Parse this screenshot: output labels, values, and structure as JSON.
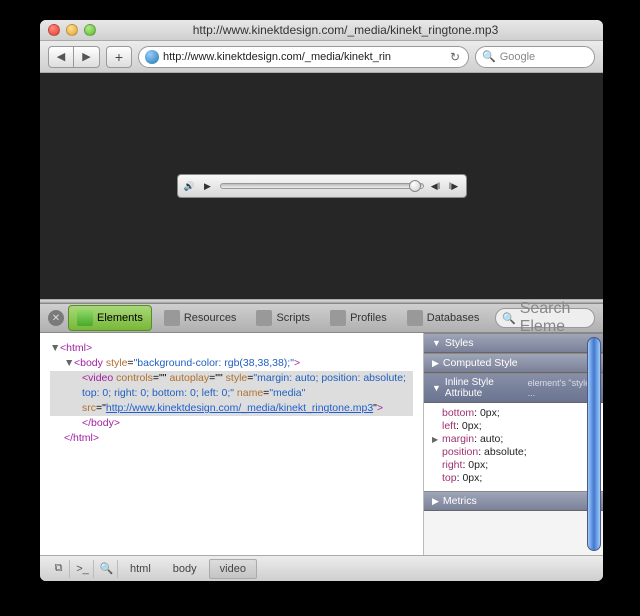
{
  "window": {
    "title": "http://www.kinektdesign.com/_media/kinekt_ringtone.mp3"
  },
  "toolbar": {
    "url": "http://www.kinektdesign.com/_media/kinekt_rin",
    "search_placeholder": "Google"
  },
  "devtools": {
    "tabs": [
      "Elements",
      "Resources",
      "Scripts",
      "Profiles",
      "Databases"
    ],
    "search_placeholder": "Search Eleme",
    "styles": {
      "header": "Styles",
      "computed": "Computed Style",
      "inline_header": "Inline Style Attribute",
      "inline_note": "element's \"style\" ...",
      "metrics": "Metrics",
      "props": [
        {
          "name": "bottom",
          "value": "0px;"
        },
        {
          "name": "left",
          "value": "0px;"
        },
        {
          "name": "margin",
          "value": "auto;",
          "expandable": true
        },
        {
          "name": "position",
          "value": "absolute;"
        },
        {
          "name": "right",
          "value": "0px;"
        },
        {
          "name": "top",
          "value": "0px;"
        }
      ]
    },
    "dom": {
      "html_open": "<html>",
      "body_open_tag": "<body ",
      "body_style_attr": "style",
      "body_style_val": "\"background-color: rgb(38,38,38);\"",
      "body_close_angle": ">",
      "video_open": "<video ",
      "video_controls": "controls",
      "video_eq": "=\"\" ",
      "video_autoplay": "autoplay",
      "video_style": "style",
      "video_style_val": "\"margin: auto; position: absolute; top: 0; right: 0; bottom: 0; left: 0;\"",
      "video_name": "name",
      "video_name_val": "\"media\"",
      "video_src": "src",
      "video_src_val": "http://www.kinektdesign.com/_media/kinekt_ringtone.mp3",
      "video_close": ">",
      "body_close": "</body>",
      "html_close": "</html>"
    },
    "breadcrumb": [
      "html",
      "body",
      "video"
    ]
  }
}
